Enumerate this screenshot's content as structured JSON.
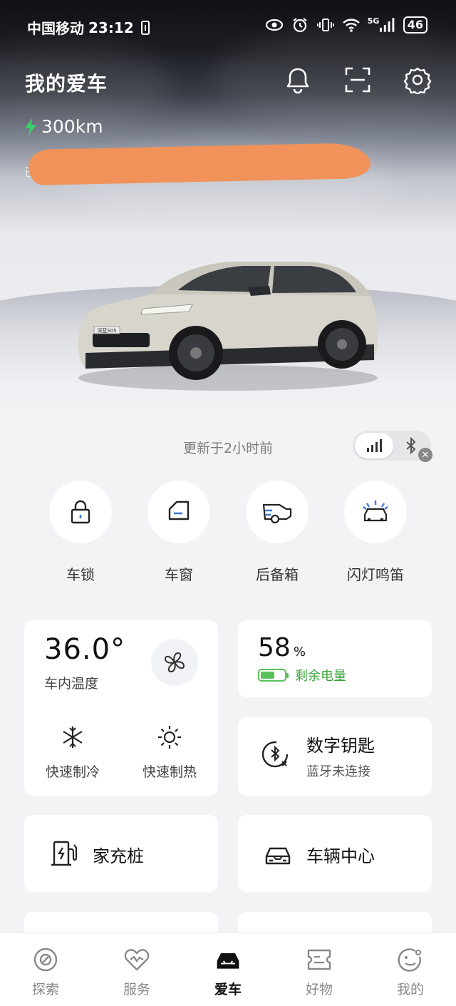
{
  "status_bar": {
    "carrier": "中国移动",
    "time": "23:12",
    "network": "5G",
    "battery": "46"
  },
  "header": {
    "title": "我的爱车",
    "range": "300km",
    "plate_partial": "已驻"
  },
  "vehicle": {
    "plate_text": "深蓝S05",
    "updated": "更新于2小时前"
  },
  "quick_controls": [
    {
      "label": "车锁",
      "icon": "lock-icon"
    },
    {
      "label": "车窗",
      "icon": "window-icon"
    },
    {
      "label": "后备箱",
      "icon": "trunk-icon"
    },
    {
      "label": "闪灯鸣笛",
      "icon": "flash-horn-icon"
    }
  ],
  "climate": {
    "temperature": "36.0°",
    "label": "车内温度",
    "cool_label": "快速制冷",
    "heat_label": "快速制热"
  },
  "battery": {
    "value": "58",
    "unit": "%",
    "label": "剩余电量",
    "level": 0.58,
    "color": "#5ac15a"
  },
  "digital_key": {
    "title": "数字钥匙",
    "status": "蓝牙未连接"
  },
  "home_charger": {
    "label": "家充桩"
  },
  "vehicle_center": {
    "label": "车辆中心"
  },
  "bottom_nav": [
    {
      "label": "探索",
      "active": false
    },
    {
      "label": "服务",
      "active": false
    },
    {
      "label": "爱车",
      "active": true
    },
    {
      "label": "好物",
      "active": false
    },
    {
      "label": "我的",
      "active": false
    }
  ]
}
